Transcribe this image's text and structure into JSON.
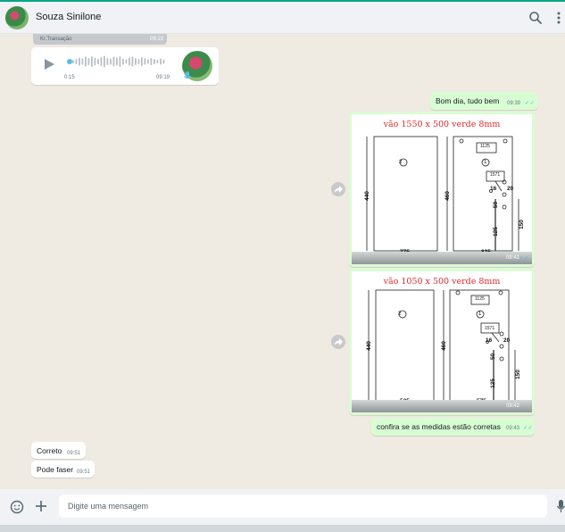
{
  "header": {
    "contact_name": "Souza Sinilone",
    "search_icon": "search-icon",
    "menu_icon": "more-vertical-icon"
  },
  "messages": {
    "quoted": {
      "label": "Kr.Transação",
      "time": "09:19"
    },
    "audio": {
      "elapsed": "0:15",
      "time": "09:19",
      "progress": 0.05
    },
    "greeting": {
      "text": "Bom dia, tudo bem",
      "time": "09:39"
    },
    "image1": {
      "title": "vão 1550 x 500 verde 8mm",
      "time": "09:41",
      "left_height": "440",
      "right_height": "460",
      "left_width": "775",
      "right_width": "825",
      "box_top": "1125",
      "box_mid": "1571",
      "dim_16": "16",
      "dim_20": "20",
      "dim_50": "50",
      "dim_125": "125",
      "dim_150": "150",
      "panel_left_no": "2",
      "panel_right_no": "1"
    },
    "image2": {
      "title": "vão 1050 x 500 verde 8mm",
      "time": "09:42",
      "left_height": "440",
      "right_height": "460",
      "left_width": "525",
      "right_width": "575",
      "box_top": "1125",
      "box_mid": "1571",
      "dim_16": "16",
      "dim_20": "20",
      "dim_50": "50",
      "dim_125": "125",
      "dim_150": "150",
      "panel_left_no": "2",
      "panel_right_no": "1"
    },
    "check": {
      "text": "confira se as medidas estão corretas",
      "time": "09:43"
    },
    "reply1": {
      "text": "Correto",
      "time": "09:51"
    },
    "reply2": {
      "text": "Pode faser",
      "time": "09:51"
    }
  },
  "composer": {
    "placeholder": "Digite uma mensagem",
    "emoji_icon": "emoji-icon",
    "attach_icon": "plus-icon",
    "mic_icon": "microphone-icon"
  },
  "colors": {
    "accent": "#00a884",
    "outgoing": "#d9fdd3",
    "incoming": "#ffffff",
    "read_tick": "#53bdeb",
    "drawing_title": "#e0282e"
  }
}
